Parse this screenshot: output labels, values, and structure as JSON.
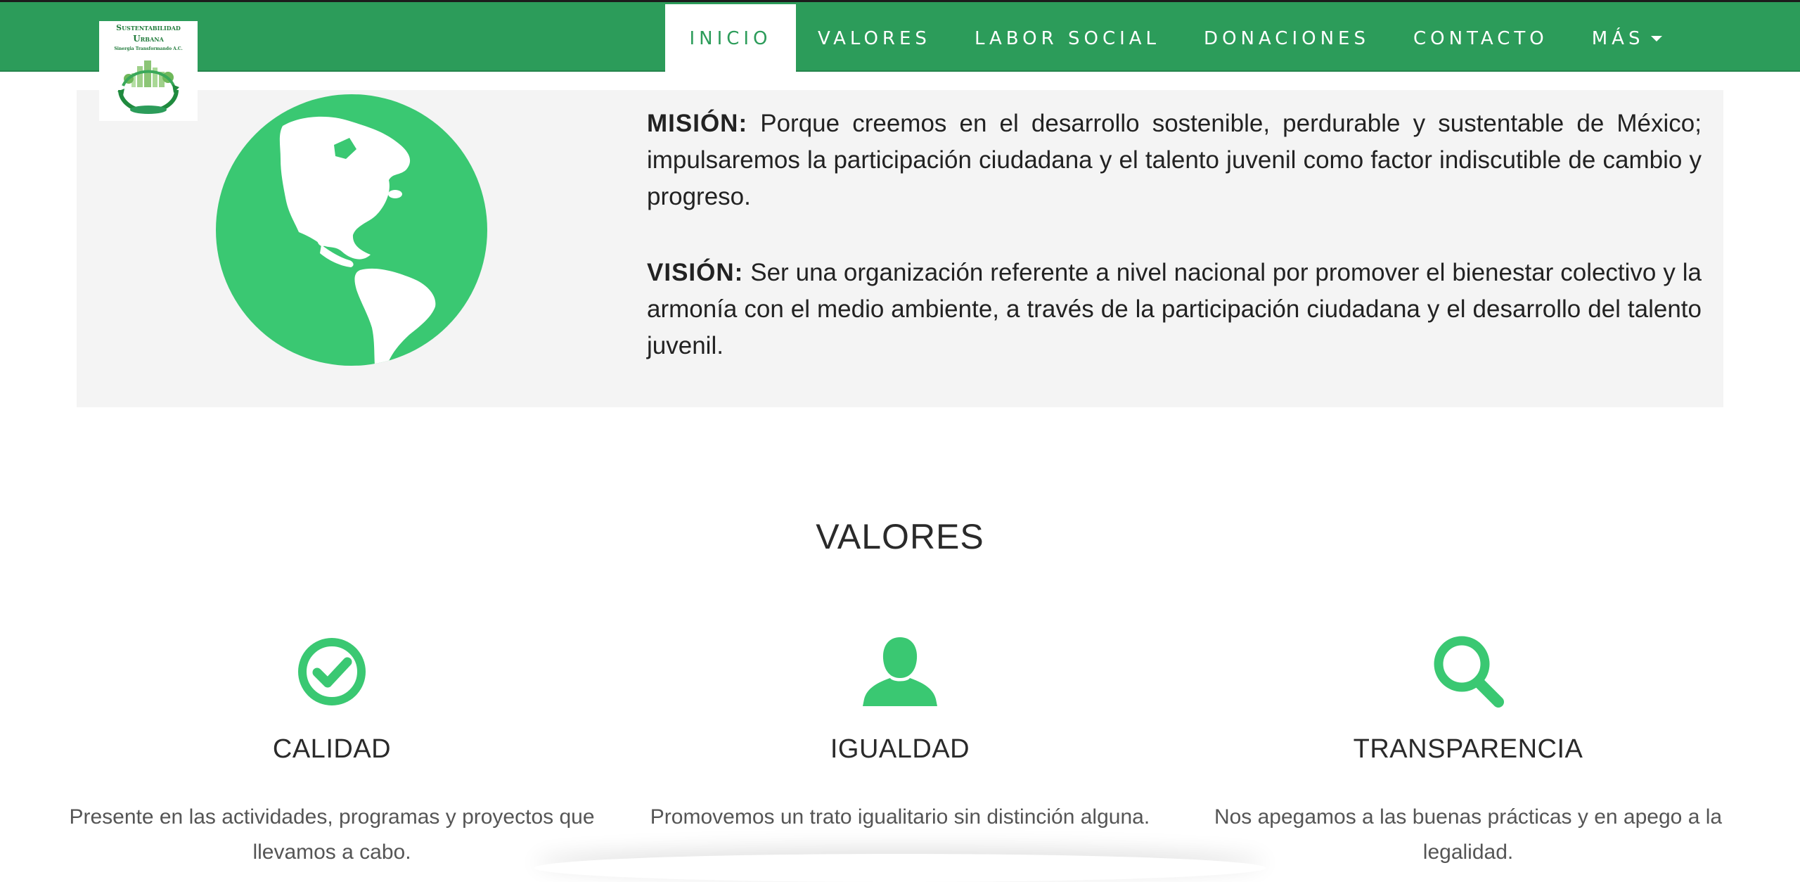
{
  "colors": {
    "brand_green": "#2c9c5a",
    "icon_green": "#3ac872",
    "panel_gray": "#f4f4f4"
  },
  "logo": {
    "line1": "Sustentabilidad",
    "line2": "Urbana",
    "line3": "Sinergia Transformando A.C.",
    "icon": "recycle-city-logo"
  },
  "nav": {
    "items": [
      {
        "label": "INICIO",
        "active": true
      },
      {
        "label": "VALORES"
      },
      {
        "label": "LABOR SOCIAL"
      },
      {
        "label": "DONACIONES"
      },
      {
        "label": "CONTACTO"
      },
      {
        "label": "MÁS",
        "dropdown": true
      }
    ]
  },
  "mission": {
    "heading": "MISIÓN:",
    "text": " Porque creemos en el desarrollo sostenible, perdurable y sustentable de México; impulsaremos la participación ciudadana y el talento juvenil como factor indiscutible de cambio y progreso."
  },
  "vision": {
    "heading": "VISIÓN:",
    "text": " Ser una organización referente a nivel nacional por promover el bienestar colectivo y la armonía con el medio ambiente, a través de la participación ciudadana y el desarrollo del talento juvenil."
  },
  "globe_icon": "globe-americas-icon",
  "valores": {
    "title": "VALORES",
    "items": [
      {
        "icon": "check-circle-icon",
        "title": "CALIDAD",
        "text": "Presente en las actividades, programas y proyectos que llevamos a cabo."
      },
      {
        "icon": "user-icon",
        "title": "IGUALDAD",
        "text": "Promovemos un trato igualitario sin distinción alguna."
      },
      {
        "icon": "search-icon",
        "title": "TRANSPARENCIA",
        "text": "Nos apegamos a las buenas prácticas y en apego a la legalidad."
      }
    ]
  }
}
